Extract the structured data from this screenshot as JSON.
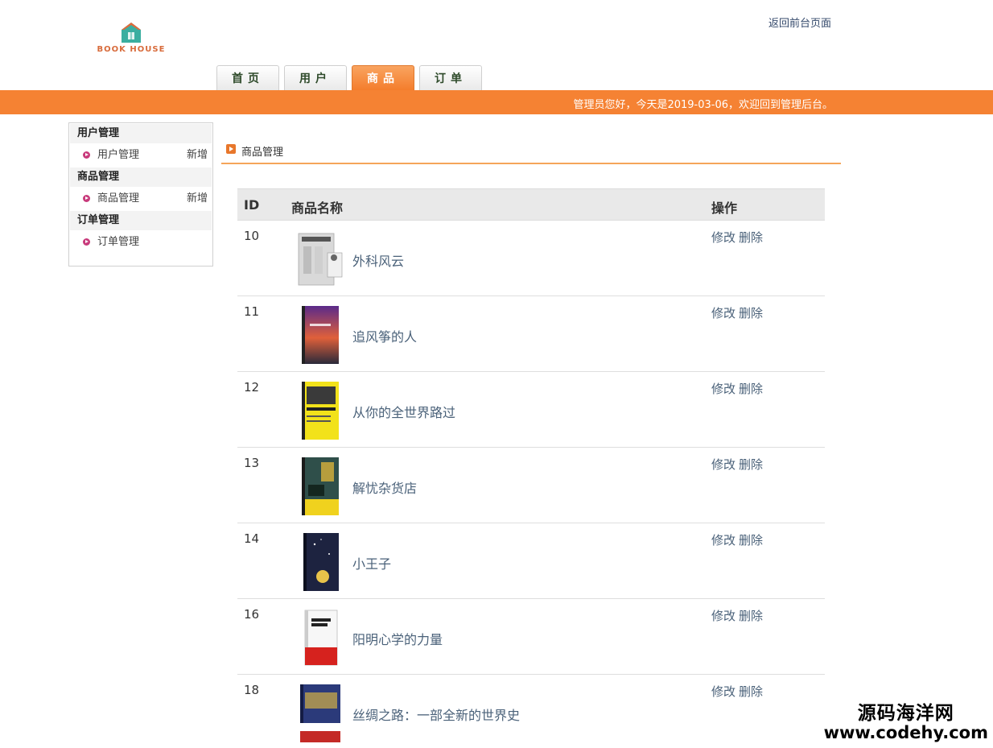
{
  "logo": {
    "text": "BOOK HOUSE",
    "color": "#d86b3b"
  },
  "header": {
    "front_link": "返回前台页面"
  },
  "nav": {
    "tabs": [
      "首页",
      "用户",
      "商品",
      "订单"
    ],
    "active": "商品"
  },
  "banner": {
    "text": "管理员您好，今天是2019-03-06，欢迎回到管理后台。",
    "color": "#f58233"
  },
  "sidebar": {
    "groups": [
      {
        "title": "用户管理",
        "item": "用户管理",
        "add": "新增"
      },
      {
        "title": "商品管理",
        "item": "商品管理",
        "add": "新增"
      },
      {
        "title": "订单管理",
        "item": "订单管理"
      }
    ]
  },
  "section": {
    "title": "商品管理"
  },
  "table": {
    "headers": {
      "id": "ID",
      "name": "商品名称",
      "ops": "操作"
    },
    "edit_label": "修改",
    "delete_label": "删除",
    "rows": [
      {
        "id": "10",
        "name": "外科风云"
      },
      {
        "id": "11",
        "name": "追风筝的人"
      },
      {
        "id": "12",
        "name": "从你的全世界路过"
      },
      {
        "id": "13",
        "name": "解忧杂货店"
      },
      {
        "id": "14",
        "name": "小王子"
      },
      {
        "id": "16",
        "name": "阳明心学的力量"
      },
      {
        "id": "18",
        "name": "丝绸之路：一部全新的世界史"
      }
    ]
  },
  "watermark": {
    "line1": "源码海洋网",
    "line2": "www.codehy.com"
  }
}
